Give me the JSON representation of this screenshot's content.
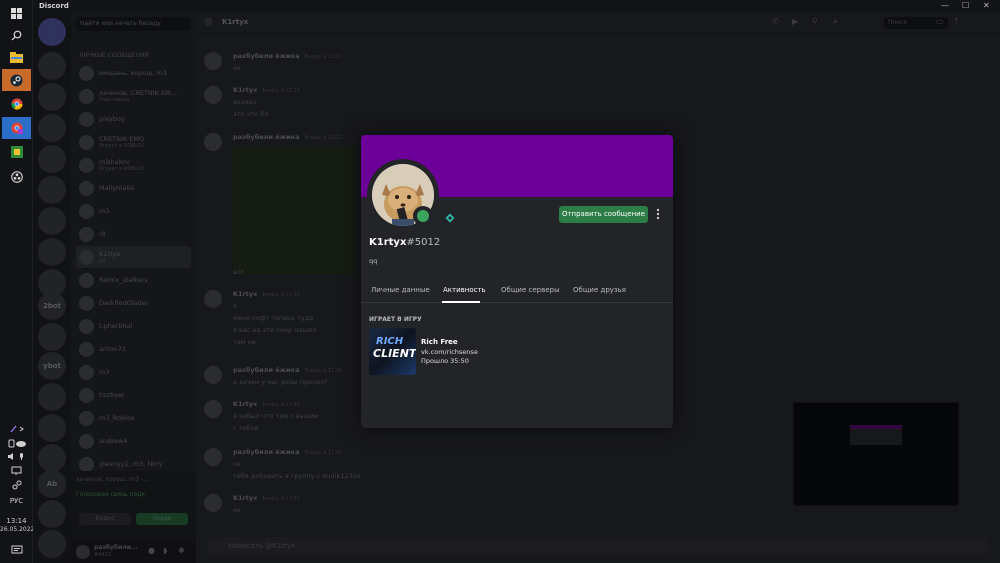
{
  "window": {
    "title": "Discord"
  },
  "taskbar": {
    "language": "РУС",
    "time": "13:14",
    "date": "26.05.2022"
  },
  "servers": {
    "labels": [
      "2bot",
      "ybot",
      "Ab"
    ]
  },
  "dms": {
    "search_placeholder": "Найти или начать беседу",
    "section_header": "ЛИЧНЫЕ СООБЩЕНИЯ",
    "items": [
      {
        "name": "мишань, хорош, m3",
        "sub": ""
      },
      {
        "name": "хачиков, CRETNIK EM...",
        "sub": "Участников"
      },
      {
        "name": "playboy",
        "sub": ""
      },
      {
        "name": "CRETNIK EMO",
        "sub": "Играет в ROBLOX"
      },
      {
        "name": "mishakov",
        "sub": "Играет в ROBLOX"
      },
      {
        "name": "Mallymalia",
        "sub": ""
      },
      {
        "name": "m3",
        "sub": ""
      },
      {
        "name": "r8",
        "sub": ""
      },
      {
        "name": "K1rtyx",
        "sub": "qq"
      },
      {
        "name": "Remix_stalkers",
        "sub": ""
      },
      {
        "name": "DarkRedGlader",
        "sub": ""
      },
      {
        "name": "t.pherbhal",
        "sub": ""
      },
      {
        "name": "anton71",
        "sub": ""
      },
      {
        "name": "m3",
        "sub": ""
      },
      {
        "name": "hzzbyer",
        "sub": ""
      },
      {
        "name": "m3_Roblox",
        "sub": ""
      },
      {
        "name": "andrew4",
        "sub": ""
      },
      {
        "name": "glavnyy1, m3, Nkry",
        "sub": ""
      }
    ],
    "voice_channel": "хачиков, хорош, m3 -...",
    "voice_status": "Голосовая связь подк",
    "video_label": "Видео",
    "screen_label": "Экран",
    "user_name": "разбубили...",
    "user_tag": "#4432"
  },
  "chat": {
    "title": "K1rtyx",
    "search_placeholder": "Поиск",
    "input_placeholder": "Написать @K1rtyx",
    "messages": [
      {
        "author": "разбубили ёжика",
        "time": "Вчера, в 11:11",
        "lines": [
          "ок"
        ]
      },
      {
        "author": "K1rtyx",
        "time": "Вчера, в 11:11",
        "lines": [
          "ахахах",
          "это что бл"
        ]
      },
      {
        "author": "разбубили ёжика",
        "time": "Вчера, в 11:12",
        "lines": []
      },
      {
        "author": "K1rtyx",
        "time": "Вчера, в 11:42",
        "lines": [
          "я",
          "меня софт теперь туда",
          "я вас на это кеер нашел",
          "там не"
        ]
      },
      {
        "author": "разбубили ёжика",
        "time": "Вчера, в 11:43",
        "lines": [
          "а зачем у нас резы просил?"
        ]
      },
      {
        "author": "K1rtyx",
        "time": "Вчера, в 11:45",
        "lines": [
          "я забыл что там с вашим",
          "с тобой"
        ]
      },
      {
        "author": "разбубили ёжика",
        "time": "Вчера, в 11:50",
        "lines": [
          "ок",
          "тебя добавить в группу с dudik123oo"
        ]
      },
      {
        "author": "K1rtyx",
        "time": "Вчера, в 11:51",
        "lines": [
          "ок"
        ]
      }
    ],
    "image_caption": "вот"
  },
  "profile": {
    "banner_color": "#6d0099",
    "status_color": "#3ba55d",
    "username": "K1rtyx",
    "discriminator": "#5012",
    "custom_status": "qq",
    "send_message_label": "Отправить сообщение",
    "send_button_color": "#2d7d46",
    "more_icon": "more-vertical-icon",
    "tabs": [
      {
        "label": "Личные данные",
        "active": false
      },
      {
        "label": "Активность",
        "active": true
      },
      {
        "label": "Общие серверы",
        "active": false
      },
      {
        "label": "Общие друзья",
        "active": false
      }
    ],
    "activity": {
      "header": "ИГРАЕТ В ИГРУ",
      "game_logo_line1": "RICH",
      "game_logo_line2": "CLIENT",
      "game_name": "Rich Free",
      "details": "vk.com/richsense",
      "elapsed": "Прошло 35:50"
    }
  }
}
